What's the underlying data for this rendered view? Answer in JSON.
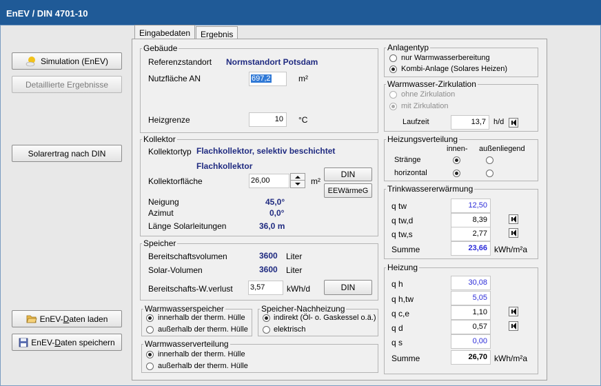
{
  "window": {
    "title": "EnEV / DIN 4701-10"
  },
  "left": {
    "simulation": "Simulation (EnEV)",
    "detail": "Detaillierte Ergebnisse",
    "solarertrag": "Solarertrag nach DIN",
    "laden_pre": "EnEV-",
    "laden_u": "D",
    "laden_post": "aten laden",
    "speichern_pre": "EnEV-",
    "speichern_u": "D",
    "speichern_post": "aten speichern"
  },
  "tabs": [
    "Eingabedaten",
    "Ergebnis"
  ],
  "gebaeude": {
    "legend": "Gebäude",
    "ref_label": "Referenzstandort",
    "ref_value": "Normstandort Potsdam",
    "nf_label": "Nutzfläche AN",
    "nf_value": "697,2",
    "nf_unit": "m²",
    "hg_label": "Heizgrenze",
    "hg_value": "10",
    "hg_unit": "°C"
  },
  "kollektor": {
    "legend": "Kollektor",
    "typ_label": "Kollektortyp",
    "typ_value": "Flachkollektor, selektiv beschichtet",
    "typ_value2": "Flachkollektor",
    "flaeche_label": "Kollektorfläche",
    "flaeche_value": "26,00",
    "flaeche_unit": "m²",
    "din_btn": "DIN",
    "eew_btn": "EEWärmeG",
    "neigung_label": "Neigung",
    "neigung_value": "45,0°",
    "azimut_label": "Azimut",
    "azimut_value": "0,0°",
    "laenge_label": "Länge Solarleitungen",
    "laenge_value": "36,0 m"
  },
  "speicher": {
    "legend": "Speicher",
    "bv_label": "Bereitschaftsvolumen",
    "bv_value": "3600",
    "bv_unit": "Liter",
    "sv_label": "Solar-Volumen",
    "sv_value": "3600",
    "sv_unit": "Liter",
    "wv_label": "Bereitschafts-W.verlust",
    "wv_value": "3,57",
    "wv_unit": "kWh/d",
    "din_btn": "DIN"
  },
  "wwspeicher": {
    "legend": "Warmwasserspeicher",
    "opt1": "innerhalb der therm. Hülle",
    "opt2": "außerhalb der therm. Hülle"
  },
  "nachheizung": {
    "legend": "Speicher-Nachheizung",
    "opt1": "indirekt (Öl- o. Gaskessel o.ä.)",
    "opt2": "elektrisch"
  },
  "wwverteilung": {
    "legend": "Warmwasserverteilung",
    "opt1": "innerhalb der therm. Hülle",
    "opt2": "außerhalb der therm. Hülle"
  },
  "anlagentyp": {
    "legend": "Anlagentyp",
    "opt1": "nur Warmwasserbereitung",
    "opt2": "Kombi-Anlage (Solares Heizen)"
  },
  "zirkulation": {
    "legend": "Warmwasser-Zirkulation",
    "opt1": "ohne Zirkulation",
    "opt2": "mit Zirkulation",
    "laufzeit_label": "Laufzeit",
    "laufzeit_value": "13,7",
    "laufzeit_unit": "h/d"
  },
  "heizverteilung": {
    "legend": "Heizungsverteilung",
    "col1": "innen-",
    "col2": "außenliegend",
    "row1": "Stränge",
    "row2": "horizontal"
  },
  "trinkwasser": {
    "legend": "Trinkwassererwärmung",
    "rows": [
      {
        "label": "q tw",
        "value": "12,50"
      },
      {
        "label": "q tw,d",
        "value": "8,39"
      },
      {
        "label": "q tw,s",
        "value": "2,77"
      }
    ],
    "sum_label": "Summe",
    "sum_value": "23,66",
    "unit": "kWh/m²a"
  },
  "heizung": {
    "legend": "Heizung",
    "rows": [
      {
        "label": "q h",
        "value": "30,08"
      },
      {
        "label": "q h,tw",
        "value": "5,05"
      },
      {
        "label": "q c,e",
        "value": "1,10"
      },
      {
        "label": "q d",
        "value": "0,57"
      },
      {
        "label": "q s",
        "value": "0,00"
      }
    ],
    "sum_label": "Summe",
    "sum_value": "26,70",
    "unit": "kWh/m²a"
  },
  "colors": {
    "titlebar": "#1f5a97",
    "value_text": "#1f2a80",
    "input_blue": "#2b2bd8"
  }
}
